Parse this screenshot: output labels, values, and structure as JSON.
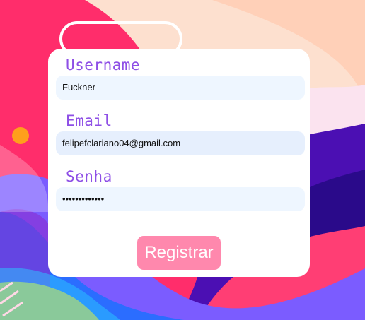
{
  "form": {
    "username_label": "Username",
    "username_value": "Fuckner",
    "email_label": "Email",
    "email_value": "felipefclariano04@gmail.com",
    "password_label": "Senha",
    "password_value": "•••••••••••••",
    "submit_label": "Registrar"
  },
  "colors": {
    "label_purple": "#8e4fe6",
    "button_pink": "#ff88ad",
    "field_bg": "#eef6ff",
    "backdrop_peach": "#fde0cf"
  }
}
